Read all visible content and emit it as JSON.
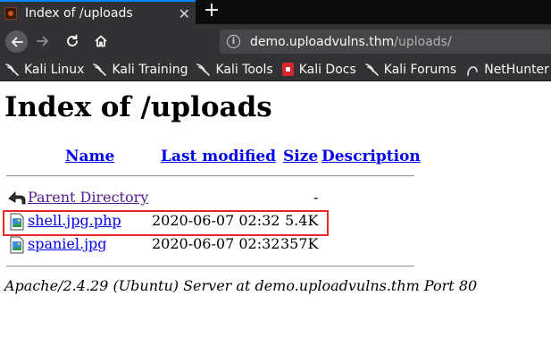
{
  "browser": {
    "tab": {
      "title": "Index of /uploads",
      "close_glyph": "✕"
    },
    "new_tab_glyph": "+",
    "url": {
      "host": "demo.uploadvulns.thm",
      "path": "/uploads/"
    },
    "bookmarks": [
      {
        "label": "Kali Linux",
        "icon": "kali-dragon-icon"
      },
      {
        "label": "Kali Training",
        "icon": "kali-dragon-icon"
      },
      {
        "label": "Kali Tools",
        "icon": "kali-dragon-icon"
      },
      {
        "label": "Kali Docs",
        "icon": "kali-docs-icon"
      },
      {
        "label": "Kali Forums",
        "icon": "kali-dragon-icon"
      },
      {
        "label": "NetHunter",
        "icon": "nethunter-icon"
      }
    ]
  },
  "page": {
    "title": "Index of /uploads",
    "columns": {
      "name": "Name",
      "last_modified": "Last modified",
      "size": "Size",
      "description": "Description"
    },
    "rows": [
      {
        "name": "Parent Directory",
        "modified": "",
        "size": "-",
        "icon": "back-folder-icon"
      },
      {
        "name": "shell.jpg.php",
        "modified": "2020-06-07 02:32",
        "size": "5.4K",
        "icon": "image-file-icon"
      },
      {
        "name": "spaniel.jpg",
        "modified": "2020-06-07 02:32",
        "size": "357K",
        "icon": "image-file-icon"
      }
    ],
    "footer": "Apache/2.4.29 (Ubuntu) Server at demo.uploadvulns.thm Port 80",
    "highlight_color": "#e8262c",
    "link_color": "#0000ee",
    "visited_color": "#551a8b"
  }
}
